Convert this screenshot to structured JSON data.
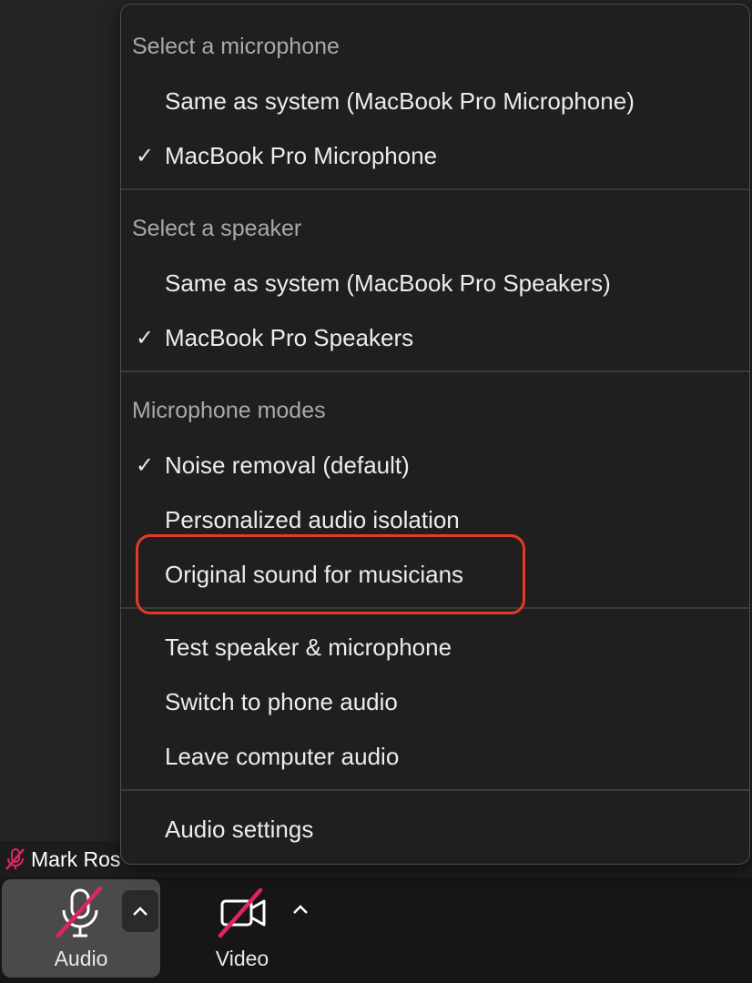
{
  "menu": {
    "sections": {
      "microphone": {
        "title": "Select a microphone",
        "items": [
          {
            "label": "Same as system (MacBook Pro Microphone)",
            "checked": false
          },
          {
            "label": "MacBook Pro Microphone",
            "checked": true
          }
        ]
      },
      "speaker": {
        "title": "Select a speaker",
        "items": [
          {
            "label": "Same as system (MacBook Pro Speakers)",
            "checked": false
          },
          {
            "label": "MacBook Pro Speakers",
            "checked": true
          }
        ]
      },
      "modes": {
        "title": "Microphone modes",
        "items": [
          {
            "label": "Noise removal (default)",
            "checked": true
          },
          {
            "label": "Personalized audio isolation",
            "checked": false
          },
          {
            "label": "Original sound for musicians",
            "checked": false
          }
        ]
      },
      "actions": {
        "items": [
          {
            "label": "Test speaker & microphone"
          },
          {
            "label": "Switch to phone audio"
          },
          {
            "label": "Leave computer audio"
          }
        ]
      },
      "settings": {
        "items": [
          {
            "label": "Audio settings"
          }
        ]
      }
    },
    "check_glyph": "✓"
  },
  "participant": {
    "name": "Mark Ros"
  },
  "toolbar": {
    "audio_label": "Audio",
    "video_label": "Video",
    "caret_glyph": "^"
  },
  "colors": {
    "highlight": "#e63a26",
    "muted_slash": "#e0245e"
  },
  "icons": {
    "audio": "microphone-muted-icon",
    "video": "camera-off-icon",
    "participant_status": "microphone-muted-icon"
  }
}
